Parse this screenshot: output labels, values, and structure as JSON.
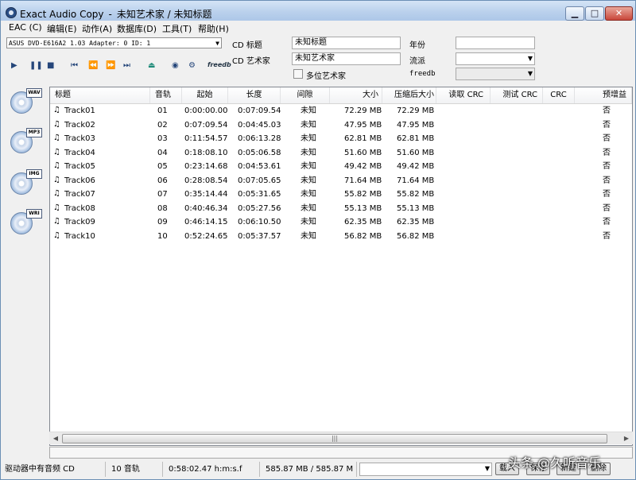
{
  "window": {
    "app_name": "Exact Audio Copy",
    "separator": "-",
    "doc_title": "未知艺术家 / 未知标题",
    "btn_minimize": "▁",
    "btn_maximize": "□",
    "btn_close": "✕"
  },
  "menu": [
    "EAC (C)",
    "编辑(E)",
    "动作(A)",
    "数据库(D)",
    "工具(T)",
    "帮助(H)"
  ],
  "drive": {
    "value": "ASUS     DVD-E616A2 1.03   Adapter: 0  ID: 1"
  },
  "toolbar": {
    "freedb_label": "freedb",
    "icons": [
      "play-icon",
      "pause-icon",
      "stop-icon",
      "first-track-icon",
      "previous-icon",
      "next-icon",
      "last-track-icon",
      "eject-icon",
      "cd-info-icon",
      "network-icon"
    ]
  },
  "cdinfo": {
    "title_label": "CD 标题",
    "title_value": "未知标题",
    "artist_label": "CD 艺术家",
    "artist_value": "未知艺术家",
    "multi_artist_label": "多位艺术家",
    "year_label": "年份",
    "year_value": "",
    "genre_label": "流派",
    "genre_value": "",
    "freedb_label": "freedb",
    "freedb_value": ""
  },
  "side_buttons": [
    {
      "tag": "WAV",
      "icon": "wav-disc-icon"
    },
    {
      "tag": "MP3",
      "icon": "mp3-disc-icon"
    },
    {
      "tag": "IMG",
      "icon": "img-disc-icon"
    },
    {
      "tag": "WRI",
      "icon": "write-disc-icon"
    }
  ],
  "columns": [
    "标题",
    "音轨",
    "起始",
    "长度",
    "间隙",
    "大小",
    "压缩后大小",
    "读取 CRC",
    "测试 CRC",
    "CRC",
    "预增益"
  ],
  "tracks": [
    {
      "title": "Track01",
      "track": "01",
      "start": "0:00:00.00",
      "length": "0:07:09.54",
      "gap": "未知",
      "size": "72.29 MB",
      "csize": "72.29 MB",
      "pregain": "否"
    },
    {
      "title": "Track02",
      "track": "02",
      "start": "0:07:09.54",
      "length": "0:04:45.03",
      "gap": "未知",
      "size": "47.95 MB",
      "csize": "47.95 MB",
      "pregain": "否"
    },
    {
      "title": "Track03",
      "track": "03",
      "start": "0:11:54.57",
      "length": "0:06:13.28",
      "gap": "未知",
      "size": "62.81 MB",
      "csize": "62.81 MB",
      "pregain": "否"
    },
    {
      "title": "Track04",
      "track": "04",
      "start": "0:18:08.10",
      "length": "0:05:06.58",
      "gap": "未知",
      "size": "51.60 MB",
      "csize": "51.60 MB",
      "pregain": "否"
    },
    {
      "title": "Track05",
      "track": "05",
      "start": "0:23:14.68",
      "length": "0:04:53.61",
      "gap": "未知",
      "size": "49.42 MB",
      "csize": "49.42 MB",
      "pregain": "否"
    },
    {
      "title": "Track06",
      "track": "06",
      "start": "0:28:08.54",
      "length": "0:07:05.65",
      "gap": "未知",
      "size": "71.64 MB",
      "csize": "71.64 MB",
      "pregain": "否"
    },
    {
      "title": "Track07",
      "track": "07",
      "start": "0:35:14.44",
      "length": "0:05:31.65",
      "gap": "未知",
      "size": "55.82 MB",
      "csize": "55.82 MB",
      "pregain": "否"
    },
    {
      "title": "Track08",
      "track": "08",
      "start": "0:40:46.34",
      "length": "0:05:27.56",
      "gap": "未知",
      "size": "55.13 MB",
      "csize": "55.13 MB",
      "pregain": "否"
    },
    {
      "title": "Track09",
      "track": "09",
      "start": "0:46:14.15",
      "length": "0:06:10.50",
      "gap": "未知",
      "size": "62.35 MB",
      "csize": "62.35 MB",
      "pregain": "否"
    },
    {
      "title": "Track10",
      "track": "10",
      "start": "0:52:24.65",
      "length": "0:05:37.57",
      "gap": "未知",
      "size": "56.82 MB",
      "csize": "56.82 MB",
      "pregain": "否"
    }
  ],
  "scroll": {
    "left": "◀",
    "right": "▶",
    "grip": "|||"
  },
  "status": {
    "drive_status": "驱动器中有音频 CD",
    "tracks": "10 音轨",
    "total_time": "0:58:02.47 h:m:s.f",
    "total_size": "585.87 MB / 585.87 M",
    "btn_load": "载入",
    "btn_save": "保存",
    "btn_new": "新建",
    "btn_delete": "删除"
  },
  "watermark": "头条 @久听音乐"
}
